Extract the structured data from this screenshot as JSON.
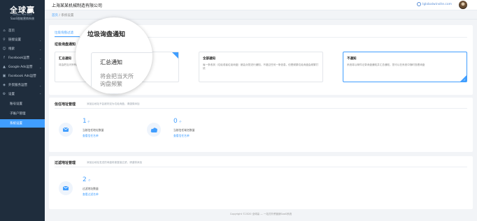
{
  "brand": {
    "logo": "全球赢",
    "logo_sub": "GLOBAL WIN SaaS",
    "subtitle": "SaaS智能营销系统"
  },
  "sidebar": {
    "items": [
      {
        "label": "首页",
        "icon": "home-icon"
      },
      {
        "label": "链接设置",
        "icon": "link-icon"
      },
      {
        "label": "线索",
        "icon": "users-icon"
      },
      {
        "label": "Facebook运营",
        "icon": "facebook-icon"
      },
      {
        "label": "Google Ads运营",
        "icon": "google-icon"
      },
      {
        "label": "Facebook Ads运营",
        "icon": "ads-icon"
      },
      {
        "label": "外贸服务运营",
        "icon": "service-icon"
      },
      {
        "label": "设置",
        "icon": "settings-icon"
      },
      {
        "label": "账号设置"
      },
      {
        "label": "子账户管理"
      },
      {
        "label": "系统设置"
      }
    ]
  },
  "topbar": {
    "company": "上海某某机械制造有限公司",
    "site": "Iglobalwinsite.com"
  },
  "breadcrumb": {
    "home": "首页",
    "sep": "/",
    "current": "系统设置"
  },
  "tabs": {
    "active": "垃圾询盘过滤"
  },
  "notify": {
    "title": "垃圾询盘通知",
    "options": [
      {
        "title": "汇总通知",
        "desc": "将会把当天所有的垃圾询盘整合成一次汇总通知，避免垃圾询盘频繁打扰您的工作"
      },
      {
        "title": "全部通知",
        "desc": "每一条收到（垃圾或者垃圾询盘）都会对您进行通知，不错过任何一条信息，但是频繁垃圾询盘会频繁打扰"
      },
      {
        "title": "不通知",
        "desc": "系统将以邮件记录询盘通知并汇总通知，您可以在系统中随时查看询盘"
      }
    ]
  },
  "trusted": {
    "title": "信任地址管理",
    "hint": "添加后地址不会被判定为垃圾询盘，请谨慎添加",
    "stats": [
      {
        "num": "1",
        "unit": "个",
        "label": "当前信任地址数量",
        "link": "查看信任名单"
      },
      {
        "num": "0",
        "unit": "个",
        "label": "当前信任域名数量",
        "link": "查看信任名单"
      }
    ]
  },
  "filter": {
    "title": "过滤地址管理",
    "hint": "添加后地址发送的询盘将被直接过滤，请谨慎添加",
    "stats": [
      {
        "num": "2",
        "unit": "个",
        "label": "过滤地址数量",
        "link": "查看过滤名单"
      }
    ]
  },
  "magnifier": {
    "tab": "垃圾询盘通知",
    "opt_title": "汇总通知",
    "line1": "将会把当天所",
    "line2": "询盘频繁"
  },
  "footer": "Copyright ©2020 全球赢 — 一站式外贸营销SaaS系统",
  "colors": {
    "accent": "#409eff",
    "sidebar": "#1f2d3d",
    "bg": "#f2f4f7"
  }
}
